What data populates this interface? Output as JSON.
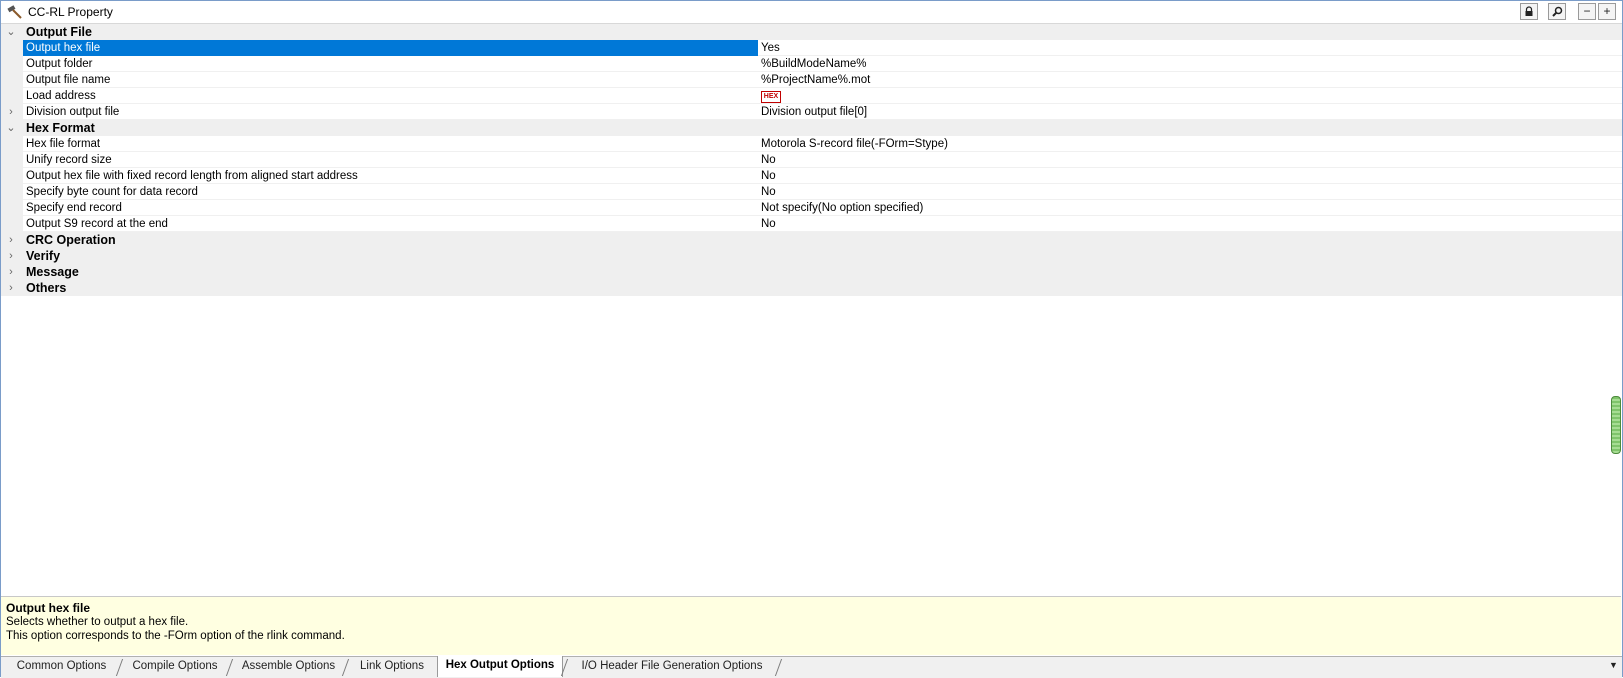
{
  "window": {
    "title": "CC-RL Property"
  },
  "grid": {
    "rows": [
      {
        "type": "category",
        "expanded": true,
        "name": "Output File"
      },
      {
        "type": "prop",
        "name": "Output hex file",
        "value": "Yes",
        "selected": true
      },
      {
        "type": "prop",
        "name": "Output folder",
        "value": "%BuildModeName%"
      },
      {
        "type": "prop",
        "name": "Output file name",
        "value": "%ProjectName%.mot"
      },
      {
        "type": "prop",
        "name": "Load address",
        "value": "",
        "icon": "hex-icon"
      },
      {
        "type": "prop",
        "name": "Division output file",
        "value": "Division output file[0]",
        "expandable": true
      },
      {
        "type": "category",
        "expanded": true,
        "name": "Hex Format"
      },
      {
        "type": "prop",
        "name": "Hex file format",
        "value": "Motorola S-record file(-FOrm=Stype)"
      },
      {
        "type": "prop",
        "name": "Unify record size",
        "value": "No"
      },
      {
        "type": "prop",
        "name": "Output hex file with fixed record length from aligned start address",
        "value": "No"
      },
      {
        "type": "prop",
        "name": "Specify byte count for data record",
        "value": "No"
      },
      {
        "type": "prop",
        "name": "Specify end record",
        "value": "Not specify(No option specified)"
      },
      {
        "type": "prop",
        "name": "Output S9 record at the end",
        "value": "No"
      },
      {
        "type": "category",
        "expanded": false,
        "name": "CRC Operation"
      },
      {
        "type": "category",
        "expanded": false,
        "name": "Verify"
      },
      {
        "type": "category",
        "expanded": false,
        "name": "Message"
      },
      {
        "type": "category",
        "expanded": false,
        "name": "Others"
      }
    ],
    "hex_icon_text": "HEX"
  },
  "description": {
    "title": "Output hex file",
    "line1": "Selects whether to output a hex file.",
    "line2": "This option corresponds to the -FOrm option of the rlink command."
  },
  "tabs": [
    {
      "label": "Common Options",
      "active": false
    },
    {
      "label": "Compile Options",
      "active": false
    },
    {
      "label": "Assemble Options",
      "active": false
    },
    {
      "label": "Link Options",
      "active": false
    },
    {
      "label": "Hex Output Options",
      "active": true
    },
    {
      "label": "I/O Header File Generation Options",
      "active": false
    }
  ],
  "colors": {
    "selection": "#0078d7",
    "description_bg": "#ffffe1",
    "category_bg": "#efefef"
  }
}
